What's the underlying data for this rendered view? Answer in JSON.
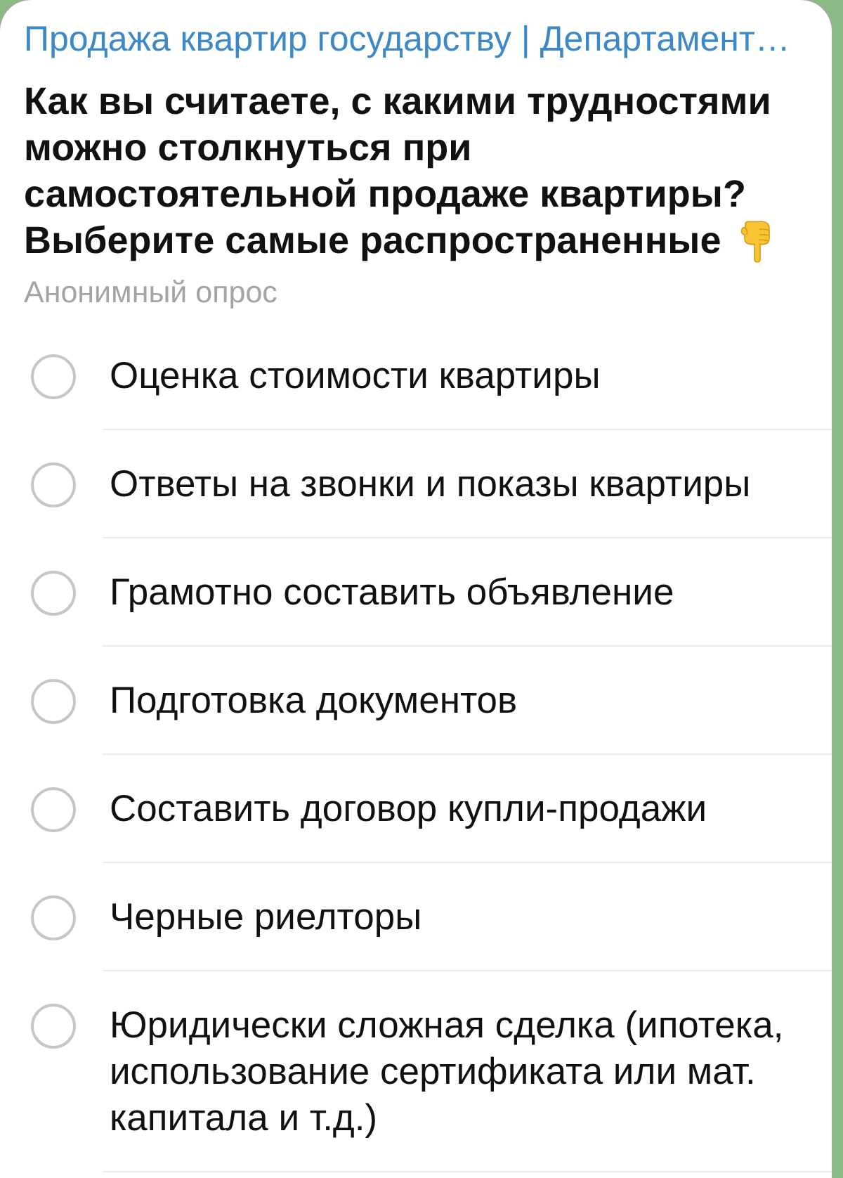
{
  "channel": {
    "title": "Продажа квартир государству | Департамент…"
  },
  "poll": {
    "question": "Как вы считаете, с какими трудностями можно столкнуться при самостоятельной продаже квартиры?",
    "instruction": "Выберите самые распространенные",
    "type": "Анонимный опрос",
    "options": [
      {
        "label": "Оценка стоимости квартиры",
        "selected": false
      },
      {
        "label": "Ответы на звонки и показы квартиры",
        "selected": false
      },
      {
        "label": "Грамотно составить объявление",
        "selected": false
      },
      {
        "label": "Подготовка документов",
        "selected": false
      },
      {
        "label": "Составить договор купли-продажи",
        "selected": false
      },
      {
        "label": "Черные риелторы",
        "selected": false
      },
      {
        "label": "Юридически сложная сделка (ипотека, использование сертификата или мат. капитала и т.д.)",
        "selected": false
      }
    ]
  }
}
